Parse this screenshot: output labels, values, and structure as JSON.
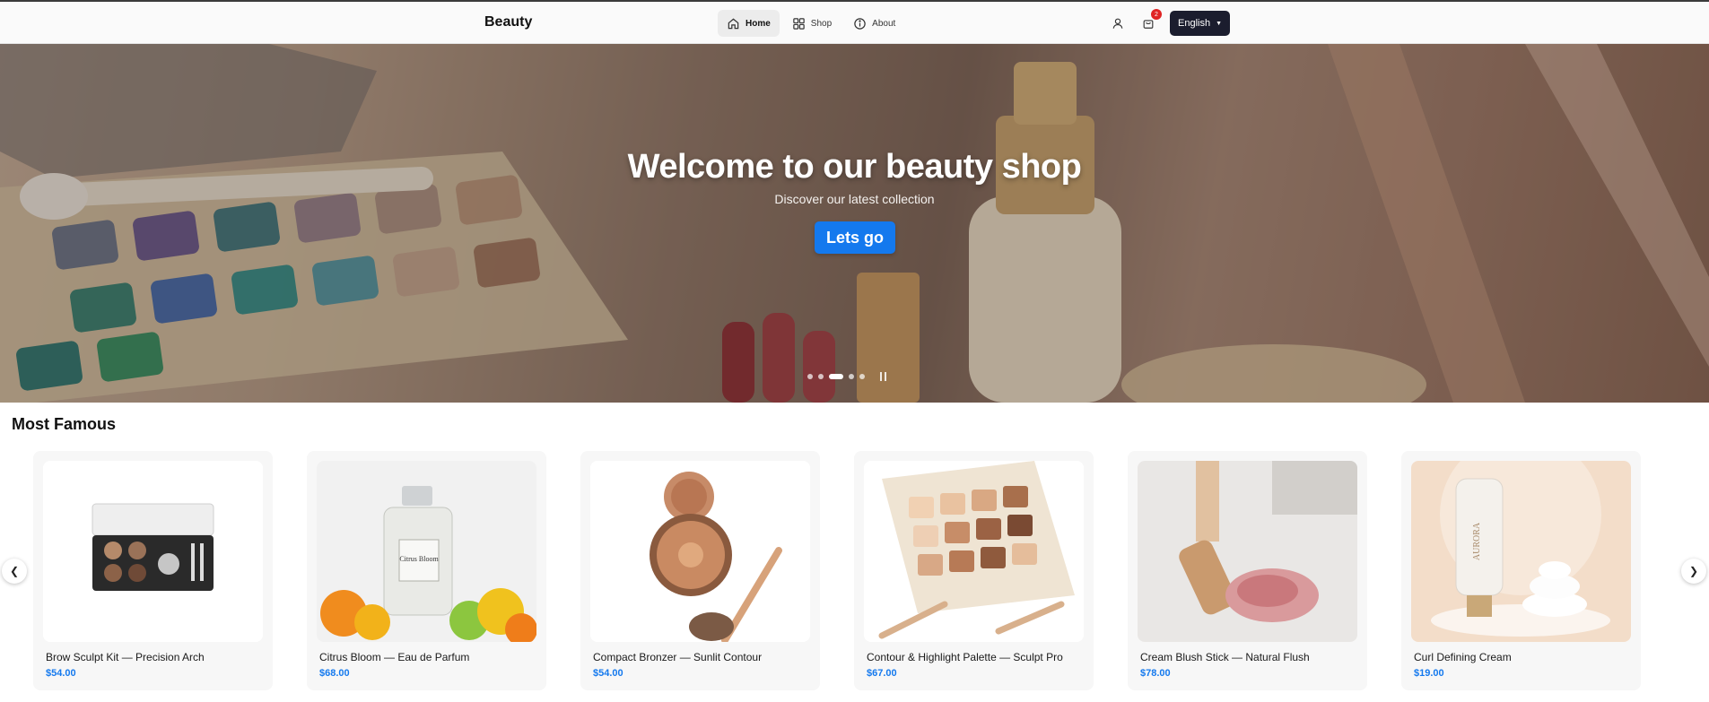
{
  "nav": {
    "brand": "Beauty",
    "links": [
      {
        "label": "Home",
        "icon": "home-icon",
        "active": true
      },
      {
        "label": "Shop",
        "icon": "grid-icon",
        "active": false
      },
      {
        "label": "About",
        "icon": "info-icon",
        "active": false
      }
    ],
    "cart_count": "2",
    "language": "English"
  },
  "hero": {
    "title": "Welcome to our beauty shop",
    "subtitle": "Discover our latest collection",
    "cta": "Lets go",
    "slides_total": 5,
    "active_slide": 3
  },
  "section": {
    "title": "Most Famous"
  },
  "products": [
    {
      "name": "Brow Sculpt Kit — Precision Arch",
      "price": "$54.00"
    },
    {
      "name": "Citrus Bloom — Eau de Parfum",
      "price": "$68.00",
      "label_text": "Citrus Bloom"
    },
    {
      "name": "Compact Bronzer — Sunlit Contour",
      "price": "$54.00"
    },
    {
      "name": "Contour & Highlight Palette — Sculpt Pro",
      "price": "$67.00"
    },
    {
      "name": "Cream Blush Stick — Natural Flush",
      "price": "$78.00"
    },
    {
      "name": "Curl Defining Cream",
      "price": "$19.00",
      "label_text": "AURORA"
    }
  ],
  "colors": {
    "accent": "#1479ee",
    "nav_bg": "#fafafa",
    "lang_bg": "#1b1d2e",
    "badge": "#e02424"
  }
}
